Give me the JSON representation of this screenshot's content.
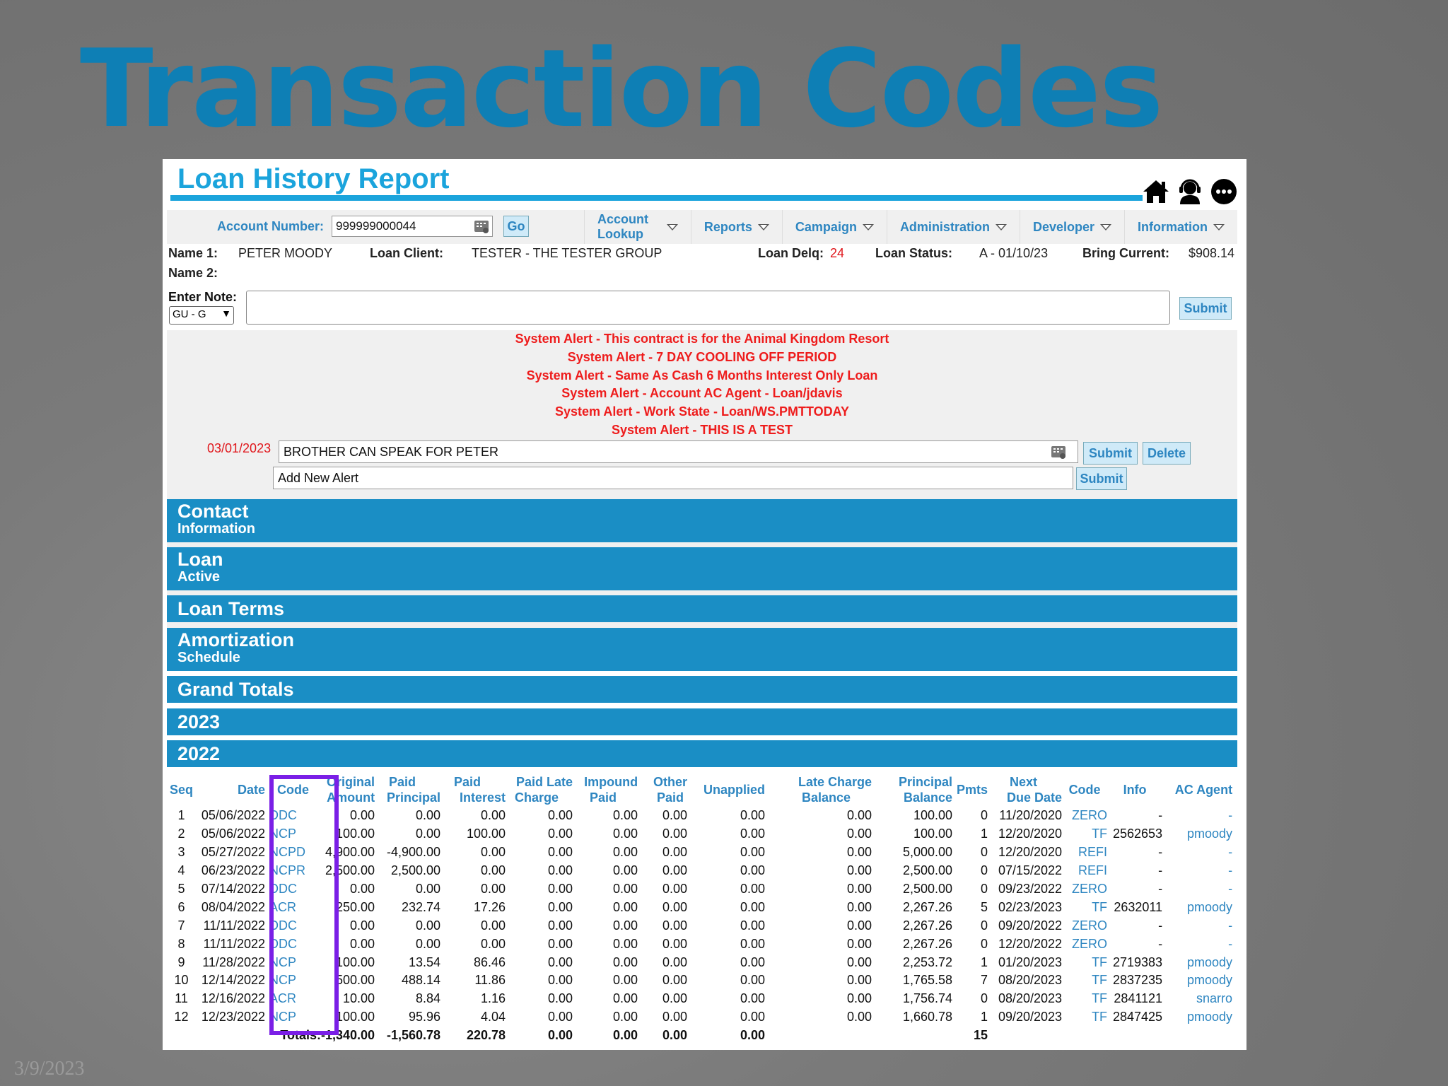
{
  "slide": {
    "title": "Transaction Codes",
    "date": "3/9/2023"
  },
  "report": {
    "title": "Loan History Report",
    "icons": [
      "home-icon",
      "support-agent-icon",
      "more-icon"
    ]
  },
  "nav": {
    "account_label": "Account Number:",
    "account_value": "999999000044",
    "go_label": "Go",
    "menu": [
      {
        "label": "Account Lookup"
      },
      {
        "label": "Reports"
      },
      {
        "label": "Campaign"
      },
      {
        "label": "Administration"
      },
      {
        "label": "Developer"
      },
      {
        "label": "Information"
      }
    ]
  },
  "info": {
    "name1_label": "Name 1:",
    "name1_value": "PETER MOODY",
    "name2_label": "Name 2:",
    "loan_client_label": "Loan Client:",
    "loan_client_value": "TESTER - THE TESTER GROUP",
    "loan_delq_label": "Loan Delq:",
    "loan_delq_value": "24",
    "loan_status_label": "Loan Status:",
    "loan_status_value": "A - 01/10/23",
    "bring_current_label": "Bring Current:",
    "bring_current_value": "$908.14"
  },
  "note": {
    "label": "Enter Note:",
    "select_value": "GU - G",
    "submit_label": "Submit"
  },
  "alerts": {
    "messages": [
      "System Alert - This contract is for the Animal Kingdom Resort",
      "System Alert - 7 DAY COOLING OFF PERIOD",
      "System Alert - Same As Cash 6 Months Interest Only Loan",
      "System Alert - Account AC Agent - Loan/jdavis",
      "System Alert - Work State - Loan/WS.PMTTODAY",
      "System Alert - THIS IS A TEST"
    ],
    "existing_date": "03/01/2023",
    "existing_text": "BROTHER CAN SPEAK FOR PETER",
    "submit_label": "Submit",
    "delete_label": "Delete",
    "new_placeholder": "Add New Alert",
    "new_submit_label": "Submit"
  },
  "sections": {
    "contact": {
      "main": "Contact",
      "sub": "Information"
    },
    "loan": {
      "main": "Loan",
      "sub": "Active"
    },
    "loan_terms": {
      "main": "Loan Terms"
    },
    "amortization": {
      "main": "Amortization",
      "sub": "Schedule"
    },
    "grand_totals": {
      "main": "Grand Totals"
    },
    "y2023": {
      "main": "2023"
    },
    "y2022": {
      "main": "2022"
    }
  },
  "table": {
    "headers": {
      "seq": "Seq",
      "date": "Date",
      "code": "Code",
      "orig1": "Original",
      "orig2": "Amount",
      "pp1": "Paid",
      "pp2": "Principal",
      "pi1": "Paid",
      "pi2": "Interest",
      "plc1": "Paid Late",
      "plc2": "Charge",
      "imp1": "Impound",
      "imp2": "Paid",
      "oth1": "Other",
      "oth2": "Paid",
      "unapplied": "Unapplied",
      "lcb1": "Late Charge",
      "lcb2": "Balance",
      "pb1": "Principal",
      "pb2": "Balance",
      "pmts": "Pmts",
      "ndd1": "Next",
      "ndd2": "Due Date",
      "code2": "Code",
      "info": "Info",
      "agent": "AC Agent"
    },
    "rows": [
      [
        "1",
        "05/06/2022",
        "DDC",
        "0.00",
        "0.00",
        "0.00",
        "0.00",
        "0.00",
        "0.00",
        "0.00",
        "0.00",
        "100.00",
        "0",
        "11/20/2020",
        "ZERO",
        "-",
        "-"
      ],
      [
        "2",
        "05/06/2022",
        "NCP",
        "100.00",
        "0.00",
        "100.00",
        "0.00",
        "0.00",
        "0.00",
        "0.00",
        "0.00",
        "100.00",
        "1",
        "12/20/2020",
        "TF",
        "2562653",
        "pmoody"
      ],
      [
        "3",
        "05/27/2022",
        "NCPD",
        "4,900.00",
        "-4,900.00",
        "0.00",
        "0.00",
        "0.00",
        "0.00",
        "0.00",
        "0.00",
        "5,000.00",
        "0",
        "12/20/2020",
        "REFI",
        "-",
        "-"
      ],
      [
        "4",
        "06/23/2022",
        "NCPR",
        "2,500.00",
        "2,500.00",
        "0.00",
        "0.00",
        "0.00",
        "0.00",
        "0.00",
        "0.00",
        "2,500.00",
        "0",
        "07/15/2022",
        "REFI",
        "-",
        "-"
      ],
      [
        "5",
        "07/14/2022",
        "DDC",
        "0.00",
        "0.00",
        "0.00",
        "0.00",
        "0.00",
        "0.00",
        "0.00",
        "0.00",
        "2,500.00",
        "0",
        "09/23/2022",
        "ZERO",
        "-",
        "-"
      ],
      [
        "6",
        "08/04/2022",
        "ACR",
        "250.00",
        "232.74",
        "17.26",
        "0.00",
        "0.00",
        "0.00",
        "0.00",
        "0.00",
        "2,267.26",
        "5",
        "02/23/2023",
        "TF",
        "2632011",
        "pmoody"
      ],
      [
        "7",
        "11/11/2022",
        "DDC",
        "0.00",
        "0.00",
        "0.00",
        "0.00",
        "0.00",
        "0.00",
        "0.00",
        "0.00",
        "2,267.26",
        "0",
        "09/20/2022",
        "ZERO",
        "-",
        "-"
      ],
      [
        "8",
        "11/11/2022",
        "DDC",
        "0.00",
        "0.00",
        "0.00",
        "0.00",
        "0.00",
        "0.00",
        "0.00",
        "0.00",
        "2,267.26",
        "0",
        "12/20/2022",
        "ZERO",
        "-",
        "-"
      ],
      [
        "9",
        "11/28/2022",
        "NCP",
        "100.00",
        "13.54",
        "86.46",
        "0.00",
        "0.00",
        "0.00",
        "0.00",
        "0.00",
        "2,253.72",
        "1",
        "01/20/2023",
        "TF",
        "2719383",
        "pmoody"
      ],
      [
        "10",
        "12/14/2022",
        "NCP",
        "500.00",
        "488.14",
        "11.86",
        "0.00",
        "0.00",
        "0.00",
        "0.00",
        "0.00",
        "1,765.58",
        "7",
        "08/20/2023",
        "TF",
        "2837235",
        "pmoody"
      ],
      [
        "11",
        "12/16/2022",
        "ACR",
        "10.00",
        "8.84",
        "1.16",
        "0.00",
        "0.00",
        "0.00",
        "0.00",
        "0.00",
        "1,756.74",
        "0",
        "08/20/2023",
        "TF",
        "2841121",
        "snarro"
      ],
      [
        "12",
        "12/23/2022",
        "NCP",
        "100.00",
        "95.96",
        "4.04",
        "0.00",
        "0.00",
        "0.00",
        "0.00",
        "0.00",
        "1,660.78",
        "1",
        "09/20/2023",
        "TF",
        "2847425",
        "pmoody"
      ]
    ],
    "totals": {
      "label": "Totals:",
      "orig": "-1,340.00",
      "pp": "-1,560.78",
      "pi": "220.78",
      "plc": "0.00",
      "imp": "0.00",
      "oth": "0.00",
      "unapplied": "0.00",
      "pmts": "15"
    }
  },
  "highlight": {
    "color": "#7a1fe6",
    "target": "Code"
  }
}
